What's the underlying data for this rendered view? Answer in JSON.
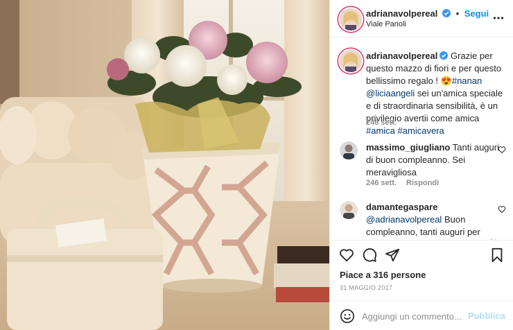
{
  "header": {
    "username": "adrianavolpereal",
    "follow_label": "Segui",
    "location": "Viale Parioli",
    "more_icon": "more-options-icon"
  },
  "caption": {
    "username": "adrianavolpereal",
    "text_1": "Grazie per questo mazzo di fiori e per questo bellissimo regalo ! ",
    "emoji": "😍",
    "tag_1": "#nanan",
    "mention_1": "@liciaangeli",
    "text_2": " sei un'amica speciale e di straordinaria sensibilità, è un privilegio avertii come amica ",
    "tag_2": "#amica",
    "tag_3": "#amicavera",
    "time": "246 sett."
  },
  "comments": [
    {
      "username": "massimo_giugliano",
      "text": "Tanti auguri di buon compleanno. Sei meravigliosa",
      "time": "246 sett.",
      "reply_label": "Rispondi"
    },
    {
      "username": "damantegaspare",
      "mention": "@adrianavolpereal",
      "text": " Buon compleanno, tanti auguri per questa giornata speciale 🎂🥂💐🌹"
    }
  ],
  "actions": {
    "likes": "Piace a 316 persone",
    "date": "31 MAGGIO 2017"
  },
  "add_comment": {
    "placeholder": "Aggiungi un commento...",
    "publish_label": "Pubblica"
  },
  "colors": {
    "accent": "#0095f6",
    "verified": "#3897f0",
    "link": "#00376b",
    "muted": "#8e8e8e",
    "publish_disabled": "#b2dffc"
  }
}
